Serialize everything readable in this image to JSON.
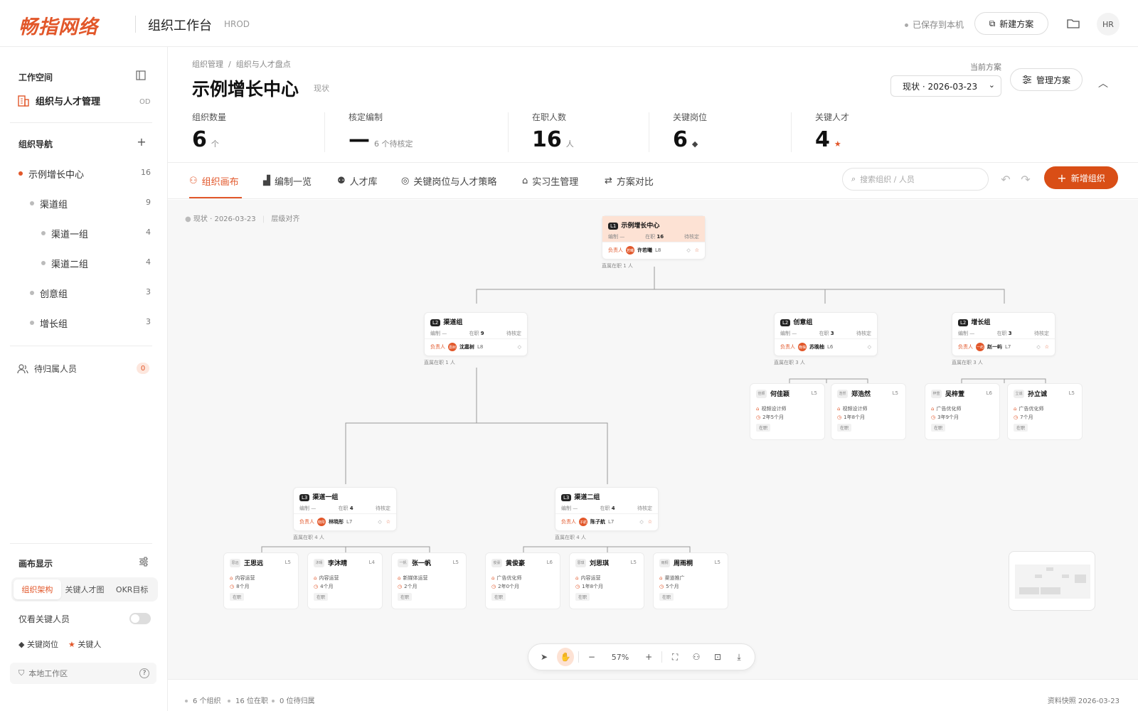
{
  "header": {
    "brand": "畅指网络",
    "app_title": "组织工作台",
    "app_sub": "HROD",
    "saved_status": "已保存到本机",
    "new_plan": "新建方案",
    "avatar": "HR"
  },
  "sidebar": {
    "workspace_label": "工作空间",
    "workspace_name": "组织与人才管理",
    "workspace_tag": "OD",
    "nav_label": "组织导航",
    "items": [
      {
        "label": "示例增长中心",
        "count": "16"
      },
      {
        "label": "渠道组",
        "count": "9"
      },
      {
        "label": "渠道一组",
        "count": "4"
      },
      {
        "label": "渠道二组",
        "count": "4"
      },
      {
        "label": "创意组",
        "count": "3"
      },
      {
        "label": "增长组",
        "count": "3"
      }
    ],
    "pending_label": "待归属人员",
    "pending_count": "0",
    "canvas_display": "画布显示",
    "segments": [
      "组织架构",
      "关键人才图",
      "OKR目标"
    ],
    "key_only": "仅看关键人员",
    "legend_key_post": "关键岗位",
    "legend_key_talent": "关键人",
    "local_ws": "本地工作区"
  },
  "main": {
    "breadcrumb": [
      "组织管理",
      "/",
      "组织与人才盘点"
    ],
    "title": "示例增长中心",
    "title_tag": "现状",
    "plan_label": "当前方案",
    "plan_select": "现状 · 2026-03-23",
    "manage_plan": "管理方案",
    "stats": [
      {
        "label": "组织数量",
        "value": "6",
        "unit": "个"
      },
      {
        "label": "核定编制",
        "value": "—",
        "unit": "6 个待核定"
      },
      {
        "label": "在职人数",
        "value": "16",
        "unit": "人"
      },
      {
        "label": "关键岗位",
        "value": "6",
        "unit": "◆"
      },
      {
        "label": "关键人才",
        "value": "4",
        "unit": "★"
      }
    ],
    "tabs": [
      "组织画布",
      "编制一览",
      "人才库",
      "关键岗位与人才策略",
      "实习生管理",
      "方案对比"
    ],
    "search_placeholder": "搜索组织 / 人员",
    "add_org": "新增组织"
  },
  "canvas": {
    "meta": "现状 · 2026-03-23",
    "meta2": "层级对齐",
    "common": {
      "bianzhi": "编制",
      "dash": "—",
      "zaizhi": "在职",
      "daihe": "待核定",
      "owner": "负责人"
    },
    "orgs": [
      {
        "lv": "L1",
        "name": "示例增长中心",
        "count": "16",
        "owner": "许若曦",
        "ava": "若曦",
        "olv": "L8",
        "note": "直属在职 1 人"
      },
      {
        "lv": "L2",
        "name": "渠道组",
        "count": "9",
        "owner": "沈嘉树",
        "ava": "嘉树",
        "olv": "L8",
        "note": "直属在职 1 人"
      },
      {
        "lv": "L2",
        "name": "创意组",
        "count": "3",
        "owner": "苏晚柚",
        "ava": "晚柚",
        "olv": "L6",
        "note": "直属在职 3 人"
      },
      {
        "lv": "L2",
        "name": "增长组",
        "count": "3",
        "owner": "赵一屿",
        "ava": "一屿",
        "olv": "L7",
        "note": "直属在职 3 人"
      },
      {
        "lv": "L3",
        "name": "渠道一组",
        "count": "4",
        "owner": "林晓彤",
        "ava": "晓彤",
        "olv": "L7",
        "note": "直属在职 4 人"
      },
      {
        "lv": "L3",
        "name": "渠道二组",
        "count": "4",
        "owner": "陈子航",
        "ava": "子航",
        "olv": "L7",
        "note": "直属在职 4 人"
      }
    ],
    "people": [
      {
        "ava": "佳颖",
        "name": "何佳颖",
        "lv": "L5",
        "role": "视频设计师",
        "dur": "2年5个月",
        "st": "在职"
      },
      {
        "ava": "浩然",
        "name": "郑浩然",
        "lv": "L5",
        "role": "视频设计师",
        "dur": "1年8个月",
        "st": "在职"
      },
      {
        "ava": "梓萱",
        "name": "吴梓萱",
        "lv": "L6",
        "role": "广告优化师",
        "dur": "3年9个月",
        "st": "在职"
      },
      {
        "ava": "立诚",
        "name": "孙立诚",
        "lv": "L5",
        "role": "广告优化师",
        "dur": "7个月",
        "st": "在职"
      },
      {
        "ava": "思远",
        "name": "王思远",
        "lv": "L5",
        "role": "内容运营",
        "dur": "8个月",
        "st": "在职"
      },
      {
        "ava": "沐晴",
        "name": "李沐晴",
        "lv": "L4",
        "role": "内容运营",
        "dur": "4个月",
        "st": "在职"
      },
      {
        "ava": "一帆",
        "name": "张一帆",
        "lv": "L5",
        "role": "新媒体运营",
        "dur": "2个月",
        "st": "在职"
      },
      {
        "ava": "俊豪",
        "name": "黄俊豪",
        "lv": "L6",
        "role": "广告优化师",
        "dur": "2年0个月",
        "st": "在职"
      },
      {
        "ava": "思琪",
        "name": "刘思琪",
        "lv": "L5",
        "role": "内容运营",
        "dur": "1年8个月",
        "st": "在职"
      },
      {
        "ava": "雨桐",
        "name": "周雨桐",
        "lv": "L5",
        "role": "渠道推广",
        "dur": "5个月",
        "st": "在职"
      }
    ],
    "zoom": "57%"
  },
  "status": {
    "orgs": "6 个组织",
    "active": "16 位在职",
    "pending": "0 位待归属",
    "snapshot": "资料快照 2026-03-23"
  },
  "colors": {
    "accent": "#e2572a",
    "accent_dark": "#d94e16",
    "root_card": "#fde2d4"
  }
}
